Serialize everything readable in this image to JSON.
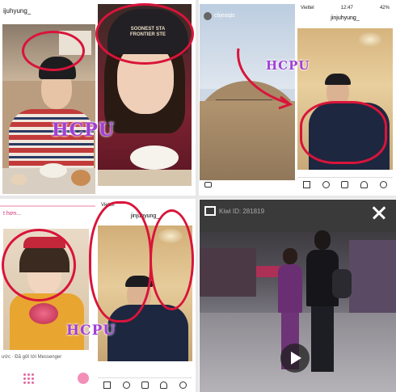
{
  "panel_tl": {
    "username": "ijuhyung_",
    "beanie_text": "SOONEST STA FRONTIER STE",
    "watermark": "HCPU"
  },
  "panel_tr": {
    "story_user": "cbjeaqis",
    "status_carrier": "Viettel",
    "status_time": "12:47",
    "status_battery": "42%",
    "profile_username": "jinjuhyung_",
    "watermark": "HCPU"
  },
  "panel_bl": {
    "header_text": "t hơn...",
    "status_carrier": "Viettel",
    "profile_username": "jinjuhyung_",
    "messenger_text": "ước · Đã gửi tới Messenger",
    "watermark": "HCPU"
  },
  "panel_br": {
    "watermark": "Kiwi ID: 281819"
  },
  "colors": {
    "red_circle": "#d9143a",
    "watermark": "#a23fd6"
  }
}
